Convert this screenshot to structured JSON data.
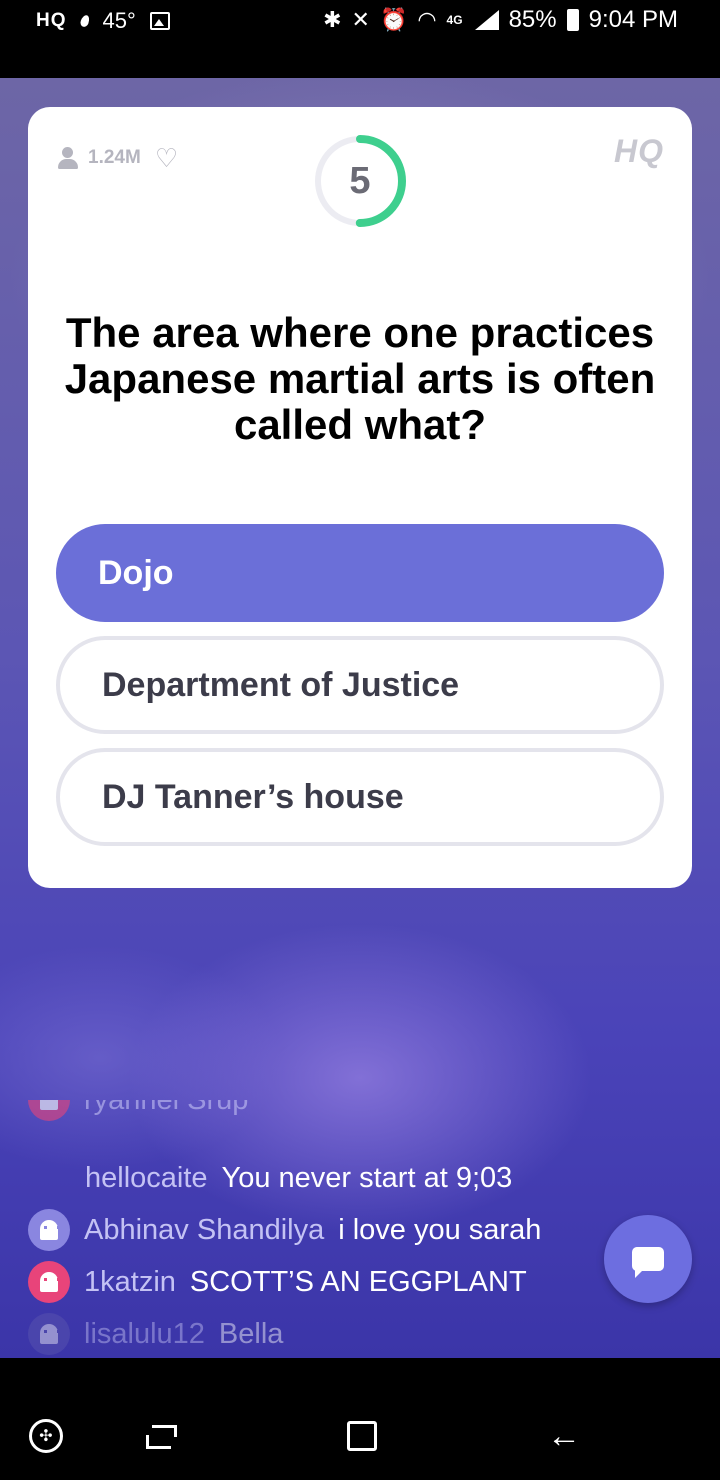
{
  "status_bar": {
    "app_badge": "HQ",
    "temperature": "45°",
    "network": "4G",
    "battery": "85%",
    "time": "9:04 PM"
  },
  "card": {
    "viewer_count": "1.24M",
    "logo": "HQ",
    "timer_value": "5",
    "timer_fraction_remaining": 0.5,
    "question": "The area where one practices Japanese martial arts is often called what?",
    "answers": [
      {
        "label": "Dojo",
        "selected": true
      },
      {
        "label": "Department of Justice",
        "selected": false
      },
      {
        "label": "DJ Tanner’s house",
        "selected": false
      }
    ]
  },
  "chat": {
    "messages": [
      {
        "user": "ryannel Srup",
        "text": "",
        "avatar_color": "#e8447a"
      },
      {
        "user": "hellocaite",
        "text": "You never start at 9;03",
        "avatar_color": ""
      },
      {
        "user": "Abhinav Shandilya",
        "text": "i love you sarah",
        "avatar_color": "#8a86e0"
      },
      {
        "user": "1katzin",
        "text": "SCOTT’S AN EGGPLANT",
        "avatar_color": "#e8447a"
      },
      {
        "user": "lisalulu12",
        "text": "Bella",
        "avatar_color": "#5c58b0"
      }
    ]
  },
  "icons": {
    "chat_button": "chat-bubble-icon",
    "nav": [
      "game-launcher-icon",
      "recent-apps-icon",
      "home-icon",
      "back-icon"
    ]
  },
  "colors": {
    "accent": "#6b6fd8",
    "timer_green": "#3ecf8e",
    "answer_border": "#e4e4ec"
  }
}
